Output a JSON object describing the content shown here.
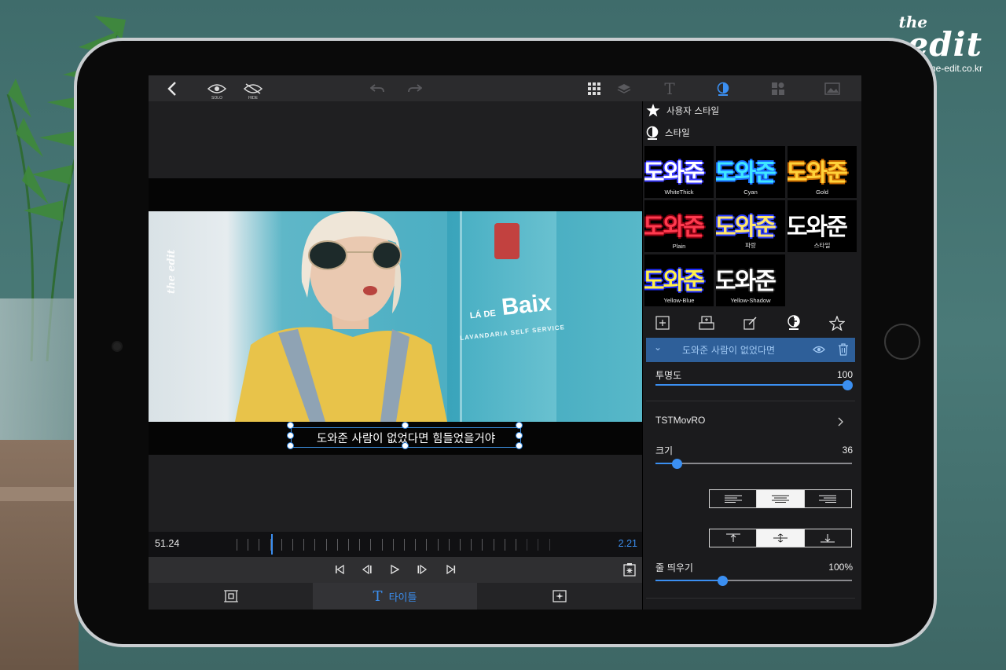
{
  "brand": {
    "the": "the",
    "edit": "edit",
    "url": "the-edit.co.kr"
  },
  "toolbar": {
    "solo_label": "SOLO",
    "hide_label": "HIDE",
    "text_tool_glyph": "T"
  },
  "video": {
    "watermark": "the edit",
    "sign_main": "Baix",
    "sign_prefix": "LÁ DE",
    "sign_sub": "LAVANDARIA SELF SERVICE",
    "subtitle": "도와준 사람이 없었다면 힘들었을거야"
  },
  "timeline": {
    "current_time": "51.24",
    "duration": "2.21"
  },
  "bottom_tabs": {
    "titles_label": "타이틀"
  },
  "panel": {
    "user_style_label": "사용자 스타일",
    "style_label": "스타일",
    "sample_text": "도와준",
    "styles": [
      {
        "name": "WhiteThick",
        "color": "#ffffff",
        "stroke": "#3b3bff"
      },
      {
        "name": "Cyan",
        "color": "#3fe6ff",
        "stroke": "#1a6fff"
      },
      {
        "name": "Gold",
        "color": "#ffd23a",
        "stroke": "#c96a00"
      },
      {
        "name": "Plain",
        "color": "#ff3a4f",
        "stroke": "#8a0010"
      },
      {
        "name": "파랑",
        "color": "#ffe66a",
        "stroke": "#2a3cff"
      },
      {
        "name": "스타일",
        "color": "#ffffff",
        "stroke": "#000000"
      },
      {
        "name": "Yellow-Blue",
        "color": "#fff04a",
        "stroke": "#1f2dff"
      },
      {
        "name": "Yellow-Shadow",
        "color": "#ffffff",
        "stroke": "#222222"
      }
    ],
    "layer_name": "도와준 사람이 없었다면",
    "opacity_label": "투명도",
    "opacity_value": "100",
    "opacity_level": 1.0,
    "font_name": "TSTMovRO",
    "size_label": "크기",
    "size_value": "36",
    "size_level": 0.09,
    "align_selected": "center",
    "valign_selected": "middle",
    "spacing_label": "줄 띄우기",
    "spacing_value": "100%",
    "spacing_level": 0.33
  },
  "colors": {
    "accent": "#3b8ff1",
    "layer_bar": "#2e5f99"
  }
}
